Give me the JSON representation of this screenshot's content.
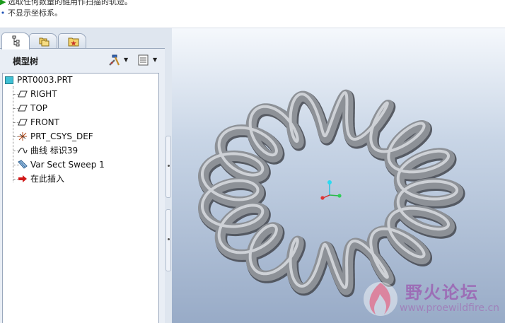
{
  "messages": [
    {
      "icon": "check-arrow-icon",
      "text": "选取任何数量的链用作扫描的轨迹。"
    },
    {
      "icon": "bullet-icon",
      "text": "不显示坐标系。"
    }
  ],
  "navigator": {
    "tabs": [
      {
        "name": "model-tree-tab",
        "icon": "tree-structure-icon",
        "active": true
      },
      {
        "name": "folder-browser-tab",
        "icon": "folders-icon",
        "active": false
      },
      {
        "name": "favorites-tab",
        "icon": "star-folder-icon",
        "active": false
      }
    ],
    "title": "模型树",
    "tools": [
      {
        "name": "tree-tools-button",
        "icon": "hammer-wrench-icon"
      },
      {
        "name": "tree-settings-button",
        "icon": "list-settings-icon"
      }
    ]
  },
  "tree": {
    "root": {
      "label": "PRT0003.PRT",
      "icon": "part-icon"
    },
    "items": [
      {
        "label": "RIGHT",
        "icon": "datum-plane-icon"
      },
      {
        "label": "TOP",
        "icon": "datum-plane-icon"
      },
      {
        "label": "FRONT",
        "icon": "datum-plane-icon"
      },
      {
        "label": "PRT_CSYS_DEF",
        "icon": "coordinate-system-icon"
      },
      {
        "label": "曲线 标识39",
        "icon": "curve-icon"
      },
      {
        "label": "Var Sect Sweep 1",
        "icon": "sweep-feature-icon"
      },
      {
        "label": "在此插入",
        "icon": "insert-here-arrow-icon"
      }
    ]
  },
  "watermark": {
    "text": "野火论坛",
    "url": "www.proewildfire.cn"
  },
  "colors": {
    "coil": "#8d9197",
    "viewport_top": "#f5f8fc",
    "viewport_bottom": "#98abc7",
    "insert_arrow": "#d01818",
    "watermark": "#9c63b3"
  }
}
